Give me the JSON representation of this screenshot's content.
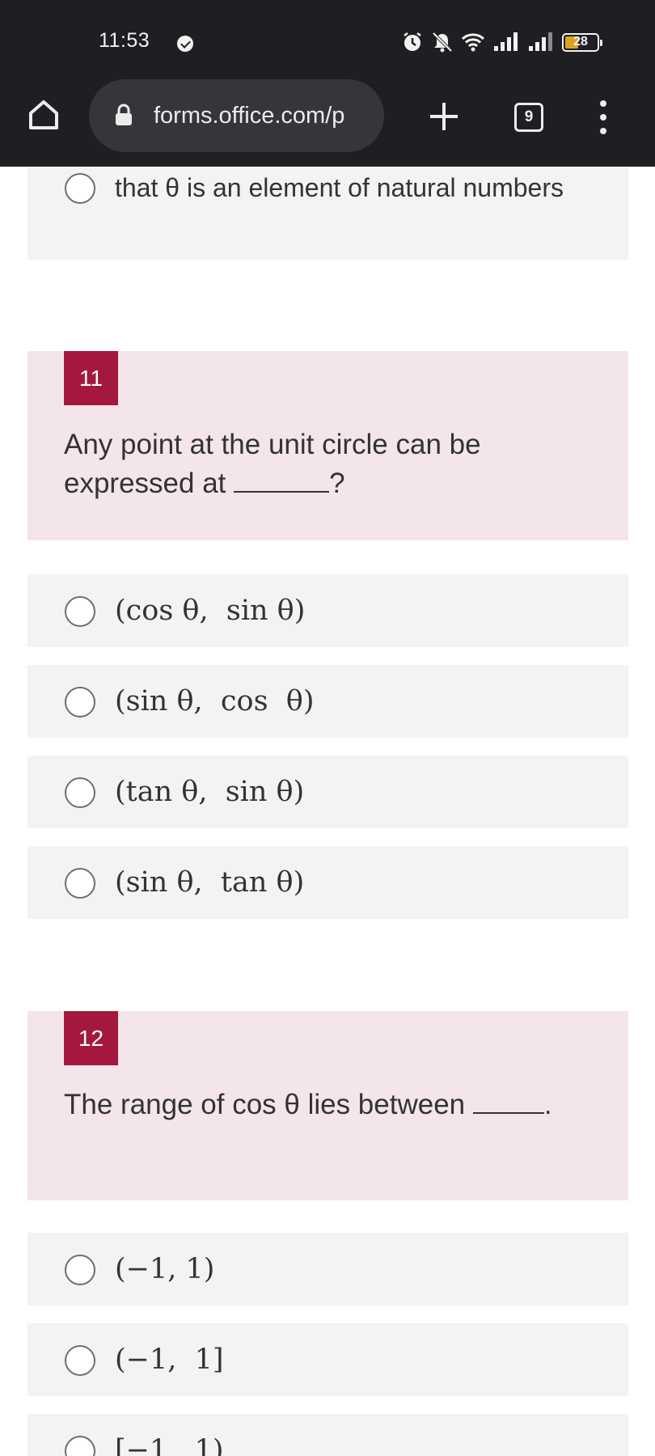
{
  "status_bar": {
    "time": "11:53",
    "battery": "28"
  },
  "browser": {
    "url": "forms.office.com/p",
    "tab_count": "9"
  },
  "prev_option": {
    "text": "that θ is an element of natural numbers"
  },
  "questions": [
    {
      "number": "11",
      "text_before": "Any point at the unit circle can be expressed at ",
      "text_after": "?",
      "options": [
        "(cos θ,  sin θ)",
        "(sin θ,  cos  θ)",
        "(tan θ,  sin θ)",
        "(sin θ,  tan θ)"
      ]
    },
    {
      "number": "12",
      "text_before": "The range of cos θ lies between ",
      "text_after": ".",
      "options": [
        "(−1, 1)",
        "(−1,  1]",
        "[−1,  1)"
      ]
    }
  ],
  "colors": {
    "accent": "#a4183f",
    "question_bg": "#f4e5ea",
    "option_bg": "#f3f3f3",
    "chrome_bg": "#1e1f22"
  }
}
